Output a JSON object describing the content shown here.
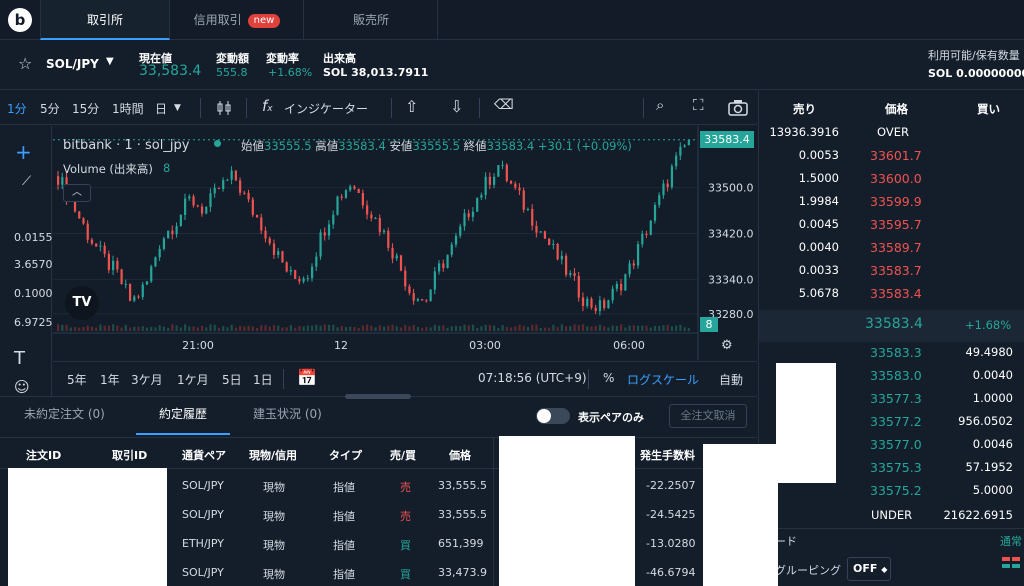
{
  "nav": {
    "tabs": [
      {
        "label": "取引所",
        "active": true
      },
      {
        "label": "信用取引",
        "badge": "new"
      },
      {
        "label": "販売所"
      }
    ]
  },
  "ticker": {
    "pair": "SOL/JPY",
    "price_label": "現在値",
    "price": "33,583.4",
    "change_label": "変動額",
    "change": "555.8",
    "rate_label": "変動率",
    "rate": "+1.68%",
    "volume_label": "出来高",
    "volume": "SOL 38,013.7911",
    "balance_label": "利用可能/保有数量",
    "balance": "SOL 0.00000000 /"
  },
  "toolbar": {
    "intervals": [
      "1分",
      "5分",
      "15分",
      "1時間",
      "日"
    ],
    "indicators_label": "インジケーター"
  },
  "chart": {
    "symbol_line": "bitbank · 1 · sol_jpy",
    "open_label": "始値",
    "open": "33555.5",
    "high_label": "高値",
    "high": "33583.4",
    "low_label": "安値",
    "low": "33555.5",
    "close_label": "終値",
    "close": "33583.4",
    "change": "+30.1 (+0.09%)",
    "volume_label": "Volume (出来高)",
    "volume_value": "8",
    "price_tag": "33583.4",
    "volume_tag": "8",
    "left_partial_values": [
      "0.0155",
      "3.6570",
      "0.1000",
      "6.9725"
    ]
  },
  "chart_data": {
    "type": "candlestick",
    "yticks": [
      "33500.0",
      "33420.0",
      "33340.0",
      "33280.0"
    ],
    "xticks": [
      "21:00",
      "12",
      "03:00",
      "06:00"
    ],
    "close_series": [
      33520,
      33470,
      33420,
      33380,
      33350,
      33300,
      33330,
      33410,
      33440,
      33480,
      33460,
      33500,
      33520,
      33470,
      33430,
      33380,
      33340,
      33350,
      33420,
      33480,
      33510,
      33470,
      33430,
      33380,
      33320,
      33300,
      33360,
      33400,
      33460,
      33500,
      33540,
      33500,
      33460,
      33420,
      33380,
      33340,
      33300,
      33290,
      33320,
      33360,
      33420,
      33480,
      33540,
      33583.4
    ],
    "ylim": [
      33250,
      33590
    ]
  },
  "bottom_toolbar": {
    "ranges": [
      "5年",
      "1年",
      "3ケ月",
      "1ケ月",
      "5日",
      "1日"
    ],
    "time": "07:18:56 (UTC+9)",
    "percent": "%",
    "log_scale": "ログスケール",
    "auto": "自動"
  },
  "orderbook": {
    "headers": {
      "sell": "売り",
      "price": "価格",
      "buy": "買い"
    },
    "over": {
      "qty": "13936.3916",
      "label": "OVER"
    },
    "asks": [
      {
        "qty": "0.0053",
        "price": "33601.7"
      },
      {
        "qty": "1.5000",
        "price": "33600.0"
      },
      {
        "qty": "1.9984",
        "price": "33599.9"
      },
      {
        "qty": "0.0045",
        "price": "33595.7"
      },
      {
        "qty": "0.0040",
        "price": "33589.7"
      },
      {
        "qty": "0.0033",
        "price": "33583.7"
      },
      {
        "qty": "5.0678",
        "price": "33583.4"
      }
    ],
    "last_price": "33583.4",
    "last_change": "+1.68%",
    "bids": [
      {
        "price": "33583.3",
        "qty": "49.4980"
      },
      {
        "price": "33583.0",
        "qty": "0.0040"
      },
      {
        "price": "33577.3",
        "qty": "1.0000"
      },
      {
        "price": "33577.2",
        "qty": "956.0502"
      },
      {
        "price": "33577.0",
        "qty": "0.0046"
      },
      {
        "price": "33575.3",
        "qty": "57.1952"
      },
      {
        "price": "33575.2",
        "qty": "5.0000"
      }
    ],
    "under": {
      "label": "UNDER",
      "qty": "21622.6915"
    },
    "mode_partial": "ード",
    "mode_value": "通常",
    "grouping_label": "グルーピング",
    "grouping_value": "OFF"
  },
  "orders_panel": {
    "tabs": [
      {
        "label": "未約定注文 (0)"
      },
      {
        "label": "約定履歴",
        "active": true
      },
      {
        "label": "建玉状況 (0)"
      }
    ],
    "toggle_label": "表示ペアのみ",
    "cancel_all": "全注文取消",
    "columns": [
      "注文ID",
      "取引ID",
      "通貨ペア",
      "現物/信用",
      "タイプ",
      "売/買",
      "価格",
      "発生手数料"
    ],
    "rows": [
      {
        "pair": "SOL/JPY",
        "kind": "現物",
        "type": "指値",
        "side": "売",
        "price": "33,555.5",
        "fee": "-22.2507"
      },
      {
        "pair": "SOL/JPY",
        "kind": "現物",
        "type": "指値",
        "side": "売",
        "price": "33,555.5",
        "fee": "-24.5425"
      },
      {
        "pair": "ETH/JPY",
        "kind": "現物",
        "type": "指値",
        "side": "買",
        "price": "651,399",
        "fee": "-13.0280"
      },
      {
        "pair": "SOL/JPY",
        "kind": "現物",
        "type": "指値",
        "side": "買",
        "price": "33,473.9",
        "fee": "-46.6794"
      }
    ]
  }
}
